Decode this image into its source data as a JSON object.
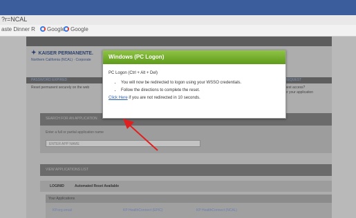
{
  "browser": {
    "url_text": "?r=NCAL",
    "bookmarks": [
      {
        "label": "aste Dinner R"
      },
      {
        "label": "Google"
      },
      {
        "label": "Google"
      }
    ]
  },
  "site": {
    "logo": "KAISER PERMANENTE.",
    "region": "Northern California (NCAL) · Corporate",
    "nav_left": "PASSWORD EXPIRED",
    "nav_right": "ACCESS REQUEST",
    "sub_left": "Reset permanent securely on the web",
    "sub_right_1": "Need to request access?",
    "sub_right_2": "Learn how for your application"
  },
  "search": {
    "header": "SEARCH FOR AN APPLICATION",
    "hint": "Enter a full or partial application name",
    "placeholder": "ENTER APP NAME"
  },
  "view": {
    "header": "VIEW APPLICATIONS LIST",
    "col1": "LOGINID",
    "col2": "Automated Reset Available",
    "my_apps": "Your Applications",
    "apps": [
      "KP.org email",
      "KP HealthConnect (EPIC)",
      "KP HealthConnect (NCAL)"
    ]
  },
  "modal": {
    "title": "Windows (PC Logon)",
    "subtitle": "PC Logon (Ctrl + Alt + Del)",
    "items": [
      "You will now be redirected to logon using your WSSO credentials.",
      "Follow the directions to complete the reset."
    ],
    "link_text": "Click Here",
    "footer_text": " if you are not redirected in 10 seconds."
  },
  "colors": {
    "modal_header": "#6aa62a",
    "arrow": "#e02020",
    "link": "#2a5db0"
  }
}
